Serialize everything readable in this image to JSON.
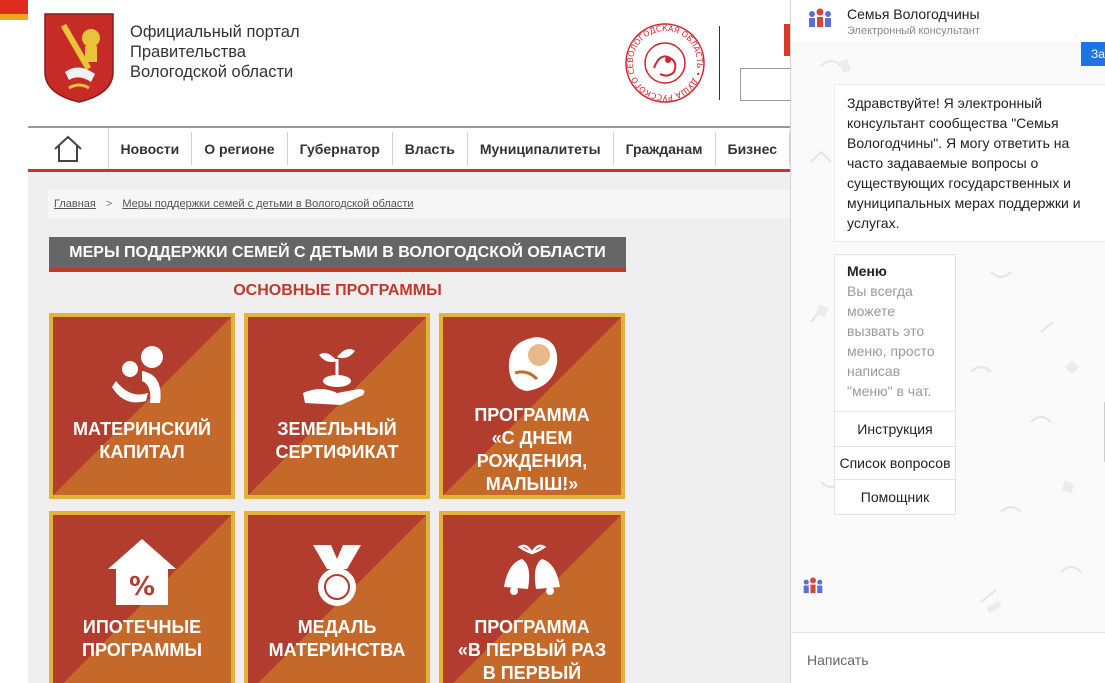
{
  "header": {
    "title_lines": [
      "Официальный портал",
      "Правительства",
      "Вологодской области"
    ],
    "stamp_text": "ВОЛОГОДСКАЯ ОБЛАСТЬ • ДУША РУССКОГО СЕВЕРА •"
  },
  "nav": {
    "home_icon": "home-icon",
    "items": [
      "Новости",
      "О регионе",
      "Губернатор",
      "Власть",
      "Муниципалитеты",
      "Гражданам",
      "Бизнес"
    ]
  },
  "breadcrumb": {
    "home": "Главная",
    "separator": ">",
    "current": "Меры поддержки семей с детьми в Вологодской области"
  },
  "page": {
    "heading": "МЕРЫ ПОДДЕРЖКИ СЕМЕЙ С ДЕТЬМИ В ВОЛОГОДСКОЙ ОБЛАСТИ",
    "section": "ОСНОВНЫЕ ПРОГРАММЫ"
  },
  "tiles": [
    {
      "icon": "mother-child-icon",
      "lines": [
        "МАТЕРИНСКИЙ",
        "КАПИТАЛ"
      ]
    },
    {
      "icon": "sprout-hand-icon",
      "lines": [
        "ЗЕМЕЛЬНЫЙ",
        "СЕРТИФИКАТ"
      ]
    },
    {
      "icon": "baby-icon",
      "lines": [
        "ПРОГРАММА",
        "«С ДНЕМ",
        "РОЖДЕНИЯ,",
        "МАЛЫШ!»"
      ]
    },
    {
      "icon": "house-percent-icon",
      "lines": [
        "ИПОТЕЧНЫЕ",
        "ПРОГРАММЫ"
      ]
    },
    {
      "icon": "medal-icon",
      "lines": [
        "МЕДАЛЬ",
        "МАТЕРИНСТВА"
      ]
    },
    {
      "icon": "bells-icon",
      "lines": [
        "ПРОГРАММА",
        "«В ПЕРВЫЙ РАЗ",
        "В ПЕРВЫЙ КЛАСС»"
      ]
    }
  ],
  "chat": {
    "name": "Семья Вологодчины",
    "subtitle": "Электронный консультант",
    "blue_button_label": "За",
    "greeting": "Здравствуйте! Я электронный консультант сообщества \"Семья Вологодчины\". Я могу ответить на часто задаваемые вопросы о существующих государственных и муниципальных мерах поддержки и услугах.",
    "menu_title": "Меню",
    "menu_desc": "Вы всегда можете вызвать это меню, просто написав \"меню\" в чат.",
    "menu_buttons": [
      "Инструкция",
      "Список вопросов",
      "Помощник"
    ],
    "input_placeholder": "Написать"
  },
  "colors": {
    "brand_red": "#c0392b",
    "tile_border": "#e2b23a",
    "chat_blue": "#1e73e8"
  }
}
